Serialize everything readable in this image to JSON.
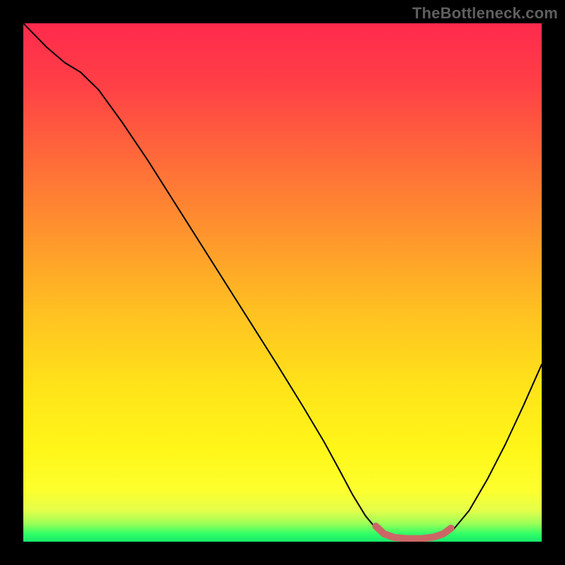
{
  "watermark": "TheBottleneck.com",
  "gradient": {
    "stops": [
      {
        "offset": 0.0,
        "color": "#ff2a4d"
      },
      {
        "offset": 0.12,
        "color": "#ff4046"
      },
      {
        "offset": 0.26,
        "color": "#ff6a3a"
      },
      {
        "offset": 0.4,
        "color": "#ff932e"
      },
      {
        "offset": 0.55,
        "color": "#ffbf22"
      },
      {
        "offset": 0.7,
        "color": "#ffe31a"
      },
      {
        "offset": 0.82,
        "color": "#fff619"
      },
      {
        "offset": 0.9,
        "color": "#fdff2d"
      },
      {
        "offset": 0.94,
        "color": "#e4ff4a"
      },
      {
        "offset": 0.965,
        "color": "#9cff57"
      },
      {
        "offset": 0.985,
        "color": "#2fff66"
      },
      {
        "offset": 1.0,
        "color": "#18e86a"
      }
    ]
  },
  "chart_data": {
    "type": "line",
    "xlim": [
      0,
      100
    ],
    "ylim": [
      0,
      100
    ],
    "curve": [
      {
        "x": 0.0,
        "y": 100.0
      },
      {
        "x": 4.5,
        "y": 95.4
      },
      {
        "x": 8.0,
        "y": 92.4
      },
      {
        "x": 11.0,
        "y": 90.6
      },
      {
        "x": 14.5,
        "y": 87.2
      },
      {
        "x": 19.0,
        "y": 81.0
      },
      {
        "x": 24.0,
        "y": 73.6
      },
      {
        "x": 29.0,
        "y": 65.7
      },
      {
        "x": 34.0,
        "y": 57.8
      },
      {
        "x": 39.0,
        "y": 49.9
      },
      {
        "x": 44.0,
        "y": 42.0
      },
      {
        "x": 49.0,
        "y": 34.1
      },
      {
        "x": 54.0,
        "y": 26.0
      },
      {
        "x": 58.0,
        "y": 19.3
      },
      {
        "x": 61.0,
        "y": 13.8
      },
      {
        "x": 63.5,
        "y": 9.1
      },
      {
        "x": 66.0,
        "y": 5.0
      },
      {
        "x": 68.5,
        "y": 2.0
      },
      {
        "x": 71.0,
        "y": 0.6
      },
      {
        "x": 74.0,
        "y": 0.3
      },
      {
        "x": 77.0,
        "y": 0.3
      },
      {
        "x": 80.0,
        "y": 0.7
      },
      {
        "x": 83.0,
        "y": 2.4
      },
      {
        "x": 86.0,
        "y": 6.0
      },
      {
        "x": 89.5,
        "y": 12.0
      },
      {
        "x": 93.0,
        "y": 18.8
      },
      {
        "x": 96.5,
        "y": 26.3
      },
      {
        "x": 100.0,
        "y": 34.2
      }
    ],
    "highlight_segment": [
      {
        "x": 68.0,
        "y": 3.0
      },
      {
        "x": 69.6,
        "y": 1.5
      },
      {
        "x": 71.6,
        "y": 0.8
      },
      {
        "x": 74.0,
        "y": 0.6
      },
      {
        "x": 77.0,
        "y": 0.6
      },
      {
        "x": 79.2,
        "y": 0.9
      },
      {
        "x": 81.0,
        "y": 1.5
      },
      {
        "x": 82.5,
        "y": 2.6
      }
    ],
    "highlight_color": "#cc6666",
    "title": "",
    "xlabel": "",
    "ylabel": ""
  }
}
